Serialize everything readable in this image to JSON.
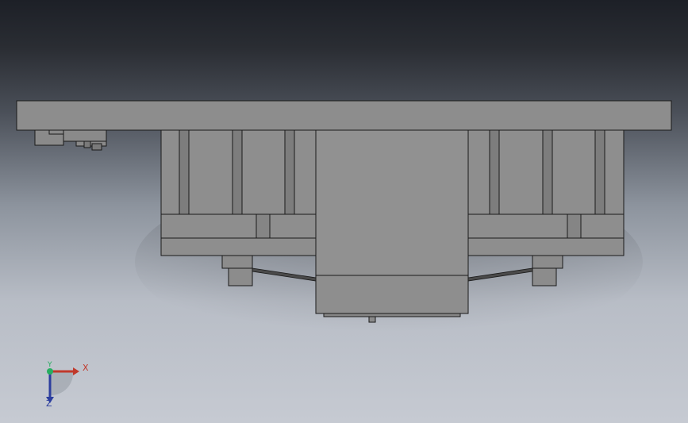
{
  "viewport": {
    "background": "#c6cad2",
    "background_top": "#1d2027"
  },
  "colors": {
    "part_face": "#8e8e8e",
    "part_light": "#9a9a9a",
    "part_dark": "#6e6e6e",
    "edge": "#1a1a1a",
    "axis_x": "#c0392b",
    "axis_y": "#27ae60",
    "axis_z": "#2c3e9e"
  },
  "triad": {
    "x_label": "X",
    "y_label": "Y",
    "z_label": "Z"
  }
}
